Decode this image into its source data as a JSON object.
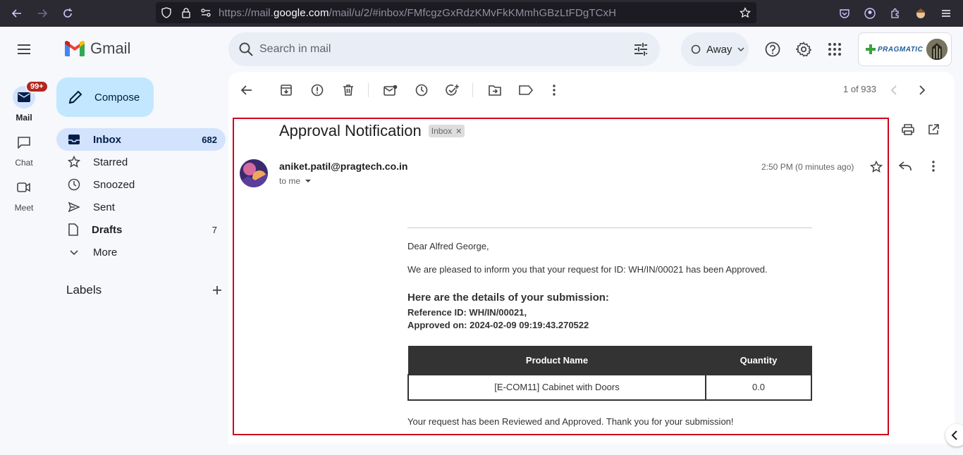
{
  "browser": {
    "url_prefix": "https://mail.",
    "url_domain": "google.com",
    "url_suffix": "/mail/u/2/#inbox/FMfcgzGxRdzKMvFkKMmhGBzLtFDgTCxH"
  },
  "app": {
    "name": "Gmail"
  },
  "rail": {
    "mail": {
      "label": "Mail",
      "badge": "99+"
    },
    "chat": {
      "label": "Chat"
    },
    "meet": {
      "label": "Meet"
    }
  },
  "search": {
    "placeholder": "Search in mail"
  },
  "status": {
    "label": "Away"
  },
  "account": {
    "org_logo_text": "PRAGMATIC"
  },
  "compose": {
    "label": "Compose"
  },
  "nav": {
    "items": [
      {
        "label": "Inbox",
        "count": "682",
        "icon": "inbox-icon"
      },
      {
        "label": "Starred",
        "count": "",
        "icon": "star-icon"
      },
      {
        "label": "Snoozed",
        "count": "",
        "icon": "clock-icon"
      },
      {
        "label": "Sent",
        "count": "",
        "icon": "send-icon"
      },
      {
        "label": "Drafts",
        "count": "7",
        "icon": "draft-icon"
      },
      {
        "label": "More",
        "count": "",
        "icon": "chevron-down-icon"
      }
    ]
  },
  "labels": {
    "title": "Labels"
  },
  "toolbar": {
    "pager": "1 of 933"
  },
  "email": {
    "subject": "Approval Notification",
    "chip": "Inbox",
    "sender": "aniket.patil@pragtech.co.in",
    "to": "to me",
    "time": "2:50 PM (0 minutes ago)",
    "greeting": "Dear Alfred George,",
    "intro": "We are pleased to inform you that your request for ID: WH/IN/00021 has been Approved.",
    "details_heading": "Here are the details of your submission:",
    "reference": "Reference ID: WH/IN/00021,",
    "approved_on": "Approved on: 2024-02-09 09:19:43.270522",
    "table": {
      "headers": [
        "Product Name",
        "Quantity"
      ],
      "rows": [
        [
          "[E-COM11] Cabinet with Doors",
          "0.0"
        ]
      ]
    },
    "closing": "Your request has been Reviewed and Approved. Thank you for your submission!"
  },
  "colors": {
    "accent": "#d3e3fd",
    "compose": "#c2e7ff",
    "frame": "#d0021b"
  }
}
